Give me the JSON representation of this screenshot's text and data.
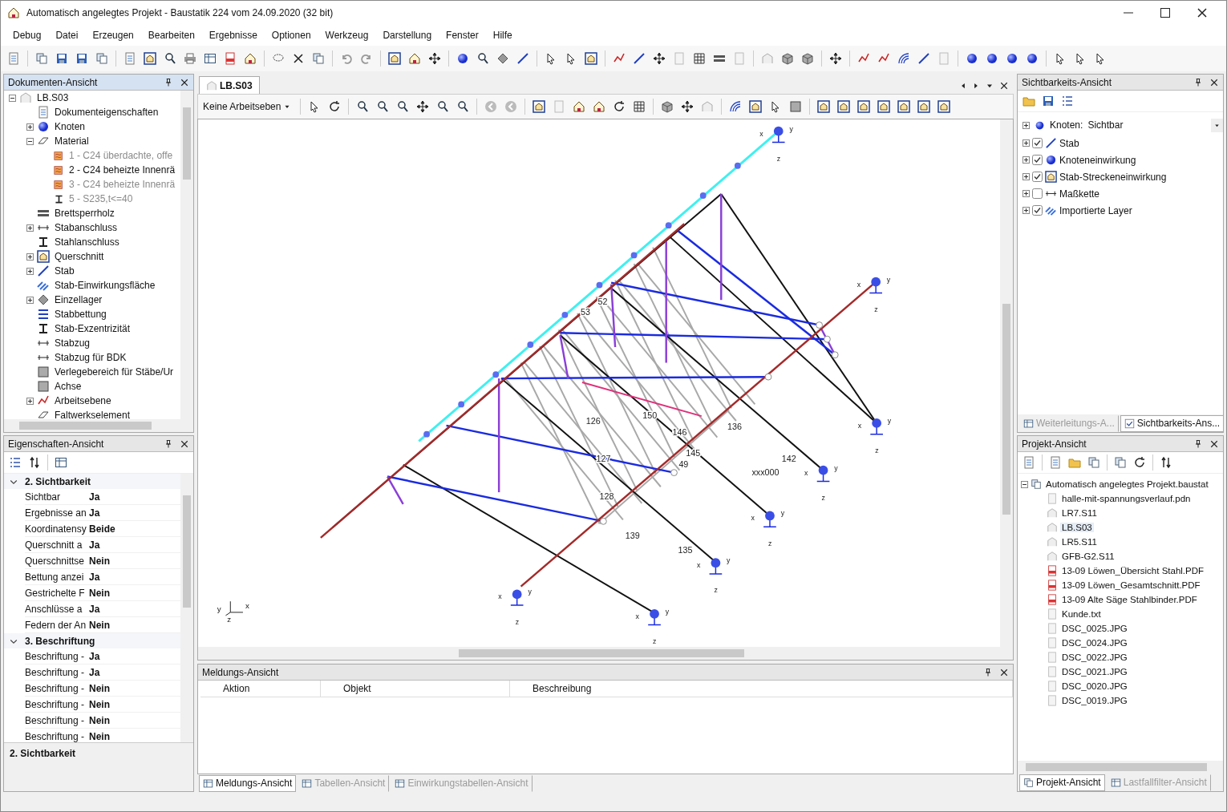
{
  "window": {
    "title": "Automatisch angelegtes Projekt - Baustatik 224 vom 24.09.2020 (32 bit)"
  },
  "menu": [
    "Debug",
    "Datei",
    "Erzeugen",
    "Bearbeiten",
    "Ergebnisse",
    "Optionen",
    "Werkzeug",
    "Darstellung",
    "Fenster",
    "Hilfe"
  ],
  "documents_panel": {
    "title": "Dokumenten-Ansicht",
    "root": {
      "label": "LB.S03",
      "expanded": true,
      "children": [
        {
          "label": "Dokumenteigenschaften",
          "kind": "leaf"
        },
        {
          "label": "Knoten",
          "kind": "group",
          "expanded": false
        },
        {
          "label": "Material",
          "kind": "group",
          "expanded": true,
          "children": [
            {
              "label": "1 - C24 überdachte, offe",
              "disabled": true
            },
            {
              "label": "2 - C24 beheizte Innenrä",
              "disabled": false
            },
            {
              "label": "3 - C24 beheizte Innenrä",
              "disabled": true
            },
            {
              "label": "5 - S235,t<=40",
              "disabled": true
            }
          ]
        },
        {
          "label": "Brettsperrholz",
          "kind": "leaf"
        },
        {
          "label": "Stabanschluss",
          "kind": "group",
          "expanded": false
        },
        {
          "label": "Stahlanschluss",
          "kind": "leaf"
        },
        {
          "label": "Querschnitt",
          "kind": "group",
          "expanded": false
        },
        {
          "label": "Stab",
          "kind": "group",
          "expanded": false
        },
        {
          "label": "Stab-Einwirkungsfläche",
          "kind": "leaf"
        },
        {
          "label": "Einzellager",
          "kind": "group",
          "expanded": false
        },
        {
          "label": "Stabbettung",
          "kind": "leaf"
        },
        {
          "label": "Stab-Exzentrizität",
          "kind": "leaf"
        },
        {
          "label": "Stabzug",
          "kind": "leaf"
        },
        {
          "label": "Stabzug für BDK",
          "kind": "leaf"
        },
        {
          "label": "Verlegebereich für Stäbe/Ur",
          "kind": "leaf"
        },
        {
          "label": "Achse",
          "kind": "leaf"
        },
        {
          "label": "Arbeitsebene",
          "kind": "group",
          "expanded": false
        },
        {
          "label": "Faltwerkselement",
          "kind": "leaf"
        }
      ]
    }
  },
  "properties_panel": {
    "title": "Eigenschaften-Ansicht",
    "categories": [
      {
        "label": "2. Sichtbarkeit",
        "expanded": true,
        "rows": [
          {
            "key": "Sichtbar",
            "value": "Ja"
          },
          {
            "key": "Ergebnisse an",
            "value": "Ja"
          },
          {
            "key": "Koordinatensy",
            "value": "Beide"
          },
          {
            "key": "Querschnitt a",
            "value": "Ja"
          },
          {
            "key": "Querschnittse",
            "value": "Nein"
          },
          {
            "key": "Bettung anzei",
            "value": "Ja"
          },
          {
            "key": "Gestrichelte F",
            "value": "Nein"
          },
          {
            "key": "Anschlüsse a",
            "value": "Ja"
          },
          {
            "key": "Federn der An",
            "value": "Nein"
          }
        ]
      },
      {
        "label": "3. Beschriftung",
        "expanded": true,
        "rows": [
          {
            "key": "Beschriftung -",
            "value": "Ja"
          },
          {
            "key": "Beschriftung -",
            "value": "Ja"
          },
          {
            "key": "Beschriftung -",
            "value": "Nein"
          },
          {
            "key": "Beschriftung -",
            "value": "Nein"
          },
          {
            "key": "Beschriftung -",
            "value": "Nein"
          },
          {
            "key": "Beschriftung -",
            "value": "Nein"
          }
        ]
      }
    ],
    "footer": "2. Sichtbarkeit"
  },
  "editor": {
    "tab": {
      "label": "LB.S03",
      "selected": true
    },
    "work_plane": "Keine Arbeitseben",
    "node_labels": [
      "52",
      "53",
      "126",
      "150",
      "146",
      "136",
      "145",
      "49",
      "142",
      "xxx000",
      "128",
      "139",
      "135",
      "127"
    ],
    "supports": [
      {
        "labels": [
          "x",
          "y",
          "z"
        ]
      },
      {
        "labels": [
          "x",
          "y",
          "z"
        ]
      },
      {
        "labels": [
          "x",
          "y",
          "z"
        ]
      },
      {
        "labels": [
          "x",
          "y",
          "z"
        ]
      },
      {
        "labels": [
          "x",
          "y",
          "z"
        ]
      },
      {
        "labels": [
          "x",
          "y",
          "z"
        ]
      },
      {
        "labels": [
          "x",
          "y",
          "z"
        ]
      },
      {
        "labels": [
          "x",
          "y",
          "z"
        ]
      }
    ],
    "triad_labels": [
      "y",
      "x",
      "z"
    ]
  },
  "messages_panel": {
    "title": "Meldungs-Ansicht",
    "columns": [
      "Aktion",
      "Objekt",
      "Beschreibung"
    ]
  },
  "center_tabs": [
    {
      "label": "Meldungs-Ansicht",
      "selected": true
    },
    {
      "label": "Tabellen-Ansicht",
      "selected": false
    },
    {
      "label": "Einwirkungstabellen-Ansicht",
      "selected": false
    }
  ],
  "visibility_panel": {
    "title": "Sichtbarkeits-Ansicht",
    "node_label": "Knoten:",
    "node_value": "Sichtbar",
    "layers": [
      {
        "label": "Stab",
        "checked": true
      },
      {
        "label": "Knoteneinwirkung",
        "checked": true
      },
      {
        "label": "Stab-Streckeneinwirkung",
        "checked": true
      },
      {
        "label": "Maßkette",
        "checked": false
      },
      {
        "label": "Importierte Layer",
        "checked": true
      }
    ],
    "tabs": [
      {
        "label": "Weiterleitungs-A...",
        "selected": false
      },
      {
        "label": "Sichtbarkeits-Ans...",
        "selected": true
      }
    ]
  },
  "project_panel": {
    "title": "Projekt-Ansicht",
    "root": {
      "label": "Automatisch angelegtes Projekt.baustat",
      "expanded": true,
      "files": [
        {
          "label": "halle-mit-spannungsverlauf.pdn",
          "selected": false
        },
        {
          "label": "LR7.S11",
          "selected": false
        },
        {
          "label": "LB.S03",
          "selected": true
        },
        {
          "label": "LR5.S11",
          "selected": false
        },
        {
          "label": "GFB-G2.S11",
          "selected": false
        },
        {
          "label": "13-09 Löwen_Übersicht Stahl.PDF",
          "selected": false
        },
        {
          "label": "13-09 Löwen_Gesamtschnitt.PDF",
          "selected": false
        },
        {
          "label": "13-09 Alte Säge Stahlbinder.PDF",
          "selected": false
        },
        {
          "label": "Kunde.txt",
          "selected": false
        },
        {
          "label": "DSC_0025.JPG",
          "selected": false
        },
        {
          "label": "DSC_0024.JPG",
          "selected": false
        },
        {
          "label": "DSC_0022.JPG",
          "selected": false
        },
        {
          "label": "DSC_0021.JPG",
          "selected": false
        },
        {
          "label": "DSC_0020.JPG",
          "selected": false
        },
        {
          "label": "DSC_0019.JPG",
          "selected": false
        }
      ]
    },
    "tabs": [
      {
        "label": "Projekt-Ansicht",
        "selected": true
      },
      {
        "label": "Lastfallfilter-Ansicht",
        "selected": false
      }
    ]
  }
}
